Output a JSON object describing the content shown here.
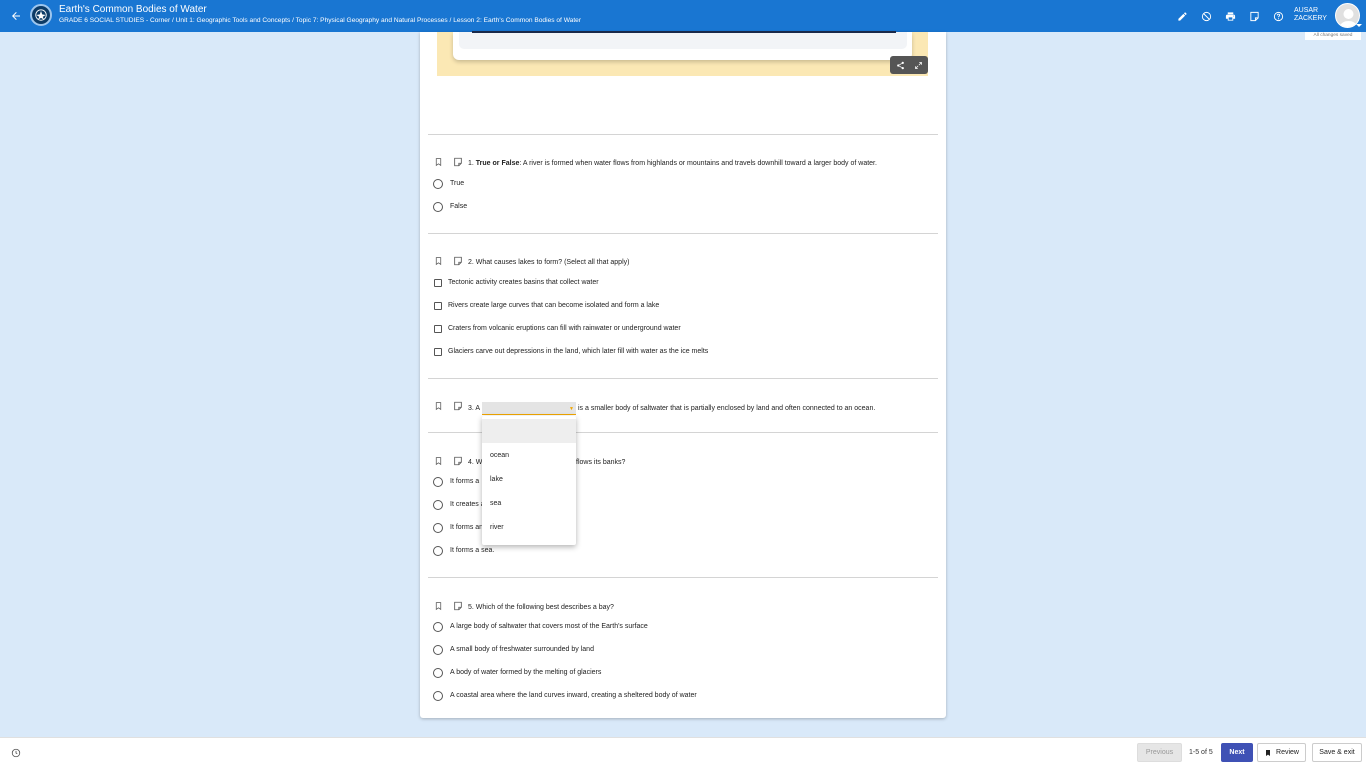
{
  "header": {
    "title": "Earth's Common Bodies of Water",
    "breadcrumb": "GRADE 6 SOCIAL STUDIES - Corner / Unit 1: Geographic Tools and Concepts / Topic 7: Physical Geography and Natural Processes / Lesson 2: Earth's Common Bodies of Water",
    "user_first": "AUSAR",
    "user_last": "ZACKERY",
    "save_status": "All changes saved",
    "icons": [
      "back-arrow-icon",
      "pencil-icon",
      "block-icon",
      "print-icon",
      "note-icon",
      "help-icon"
    ]
  },
  "questions": {
    "q1": {
      "number": "1.",
      "label_bold": "True or False",
      "text": ": A river is formed when water flows from highlands or mountains and travels downhill toward a larger body of water.",
      "options": [
        "True",
        "False"
      ]
    },
    "q2": {
      "text": "2. What causes lakes to form? (Select all that apply)",
      "options": [
        "Tectonic activity creates basins that collect water",
        "Rivers create large curves that can become isolated and form a lake",
        "Craters from volcanic eruptions can fill with rainwater or underground water",
        "Glaciers carve out depressions in the land, which later fill with water as the ice melts"
      ]
    },
    "q3": {
      "prefix": "3. A",
      "suffix": "is a smaller body of saltwater that is partially enclosed by land and often connected to an ocean.",
      "selected": "",
      "dropdown_options": [
        "ocean",
        "lake",
        "sea",
        "river"
      ]
    },
    "q4": {
      "text_start": "4. W",
      "text_end": "flows its banks?",
      "options": [
        "It forms a",
        "It creates a",
        "It forms an",
        "It forms a sea."
      ]
    },
    "q5": {
      "text": "5. Which of the following best describes a bay?",
      "options": [
        "A large body of saltwater that covers most of the Earth's surface",
        "A small body of freshwater surrounded by land",
        "A body of water formed by the melting of glaciers",
        "A coastal area where the land curves inward, creating a sheltered body of water"
      ]
    }
  },
  "footer": {
    "previous": "Previous",
    "range": "1-5 of 5",
    "next": "Next",
    "review": "Review",
    "save_exit": "Save & exit"
  },
  "colors": {
    "header_bg": "#1976d2",
    "page_bg": "#d9e9f9",
    "accent_next": "#3f51b5",
    "dropdown_underline": "#f0a500",
    "media_bg": "#fbe8b4"
  }
}
